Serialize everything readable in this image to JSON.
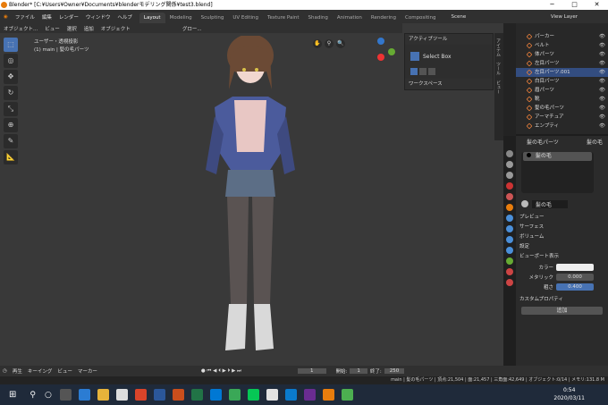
{
  "title_bar": {
    "title": "Blender* [C:¥Users¥Owner¥Documents¥blenderモデリング関係¥test3.blend]"
  },
  "menu": [
    "ファイル",
    "編集",
    "レンダー",
    "ウィンドウ",
    "ヘルプ"
  ],
  "workspaces": [
    "Layout",
    "Modeling",
    "Sculpting",
    "UV Editing",
    "Texture Paint",
    "Shading",
    "Animation",
    "Rendering",
    "Compositing"
  ],
  "scene_label": "Scene",
  "view_layer_label": "View Layer",
  "viewport_header": {
    "mode": "オブジェクト...",
    "items": [
      "ビュー",
      "選択",
      "追加",
      "オブジェクト"
    ],
    "transform": "グロー..."
  },
  "viewport": {
    "view_name": "ユーザー・透視投影",
    "object_name": "(1) main | 髪の毛パーツ"
  },
  "n_panel": {
    "active_tool_title": "アクティブツール",
    "tool_name": "Select Box",
    "workspace_title": "ワークスペース",
    "tabs": [
      "アイテム",
      "ツール",
      "ビュー"
    ]
  },
  "outliner": {
    "rows": [
      {
        "label": "パーカー",
        "selected": false
      },
      {
        "label": "ベルト",
        "selected": false
      },
      {
        "label": "体パーツ",
        "selected": false
      },
      {
        "label": "左目パーツ",
        "selected": false
      },
      {
        "label": "左目パーツ.001",
        "selected": true
      },
      {
        "label": "白目パーツ",
        "selected": false
      },
      {
        "label": "眉パーツ",
        "selected": false
      },
      {
        "label": "靴",
        "selected": false
      },
      {
        "label": "髪の毛パーツ",
        "selected": false
      },
      {
        "label": "アーマチュア",
        "selected": false
      },
      {
        "label": "エンプティ",
        "selected": false
      }
    ]
  },
  "properties": {
    "object_name": "髪の毛パーツ",
    "material_name_header": "髪の毛",
    "material_slot": "髪の毛",
    "material_field": "髪の毛",
    "sections": [
      "プレビュー",
      "サーフェス",
      "ボリューム",
      "設定"
    ],
    "viewport_display_title": "ビューポート表示",
    "fields": [
      {
        "label": "カラー",
        "value": ""
      },
      {
        "label": "メタリック",
        "value": "0.000"
      },
      {
        "label": "粗さ",
        "value": "0.400"
      }
    ],
    "custom_props_title": "カスタムプロパティ",
    "add_button": "追加"
  },
  "timeline": {
    "items": [
      "再生",
      "キーイング",
      "ビュー",
      "マーカー"
    ],
    "current_frame": "1",
    "start_label": "開始:",
    "start": "1",
    "end_label": "終了:",
    "end": "250"
  },
  "status_bar": {
    "text": "main | 髪の毛パーツ | 頂点:21,504 | 面:21,457 | 三角面:42,649 | オブジェクト:0/14 | メモリ:131.8 M"
  },
  "clock": {
    "time": "0:54",
    "date": "2020/03/11"
  },
  "colors": {
    "accent": "#4772b3",
    "selected": "#334d80",
    "orange": "#e87d0d"
  }
}
